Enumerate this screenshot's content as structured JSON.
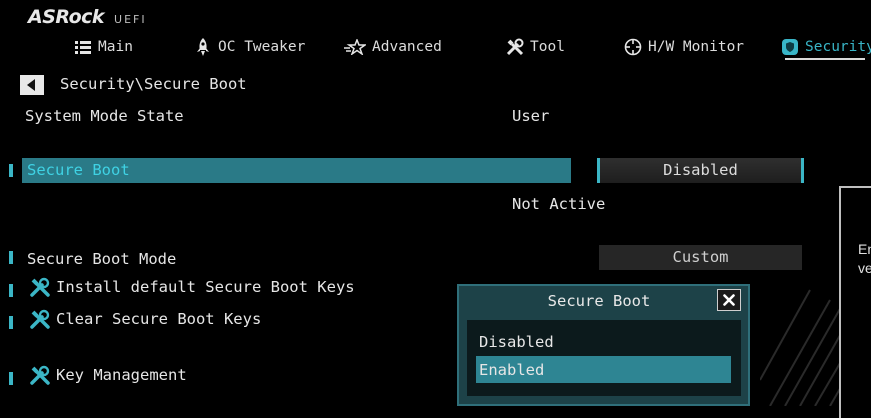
{
  "header": {
    "brand": "ASRock",
    "subtitle": "UEFI",
    "tabs": [
      {
        "label": "Main",
        "icon": "list-icon"
      },
      {
        "label": "OC Tweaker",
        "icon": "rocket-icon"
      },
      {
        "label": "Advanced",
        "icon": "star-icon"
      },
      {
        "label": "Tool",
        "icon": "tools-icon"
      },
      {
        "label": "H/W Monitor",
        "icon": "crosshair-icon"
      },
      {
        "label": "Security",
        "icon": "shield-icon",
        "active": true
      }
    ]
  },
  "breadcrumb": "Security\\Secure Boot",
  "settings": {
    "system_mode_state": {
      "label": "System Mode State",
      "value": "User"
    },
    "secure_boot": {
      "label": "Secure Boot",
      "value": "Disabled",
      "status": "Not Active"
    },
    "secure_boot_mode": {
      "label": "Secure Boot Mode",
      "value": "Custom"
    },
    "install_keys": {
      "label": "Install default Secure Boot Keys"
    },
    "clear_keys": {
      "label": "Clear Secure Boot Keys"
    },
    "key_management": {
      "label": "Key Management"
    }
  },
  "help_text": "En\nve",
  "popup": {
    "title": "Secure Boot",
    "options": [
      "Disabled",
      "Enabled"
    ],
    "selected": "Enabled"
  },
  "colors": {
    "accent": "#3bb6c6",
    "highlight_bar": "#2a7a87",
    "popup_bg": "#1d4248",
    "selected_option": "#2e8593"
  }
}
